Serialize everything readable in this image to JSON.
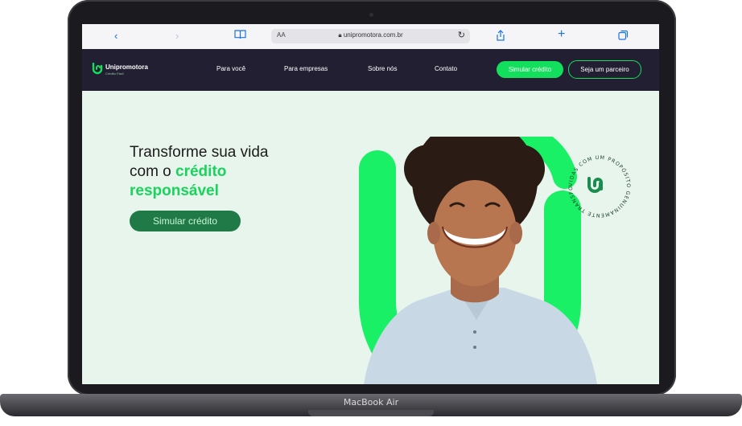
{
  "device": {
    "label": "MacBook Air"
  },
  "browser": {
    "reader_label": "AA",
    "url": "unipromotora.com.br",
    "icons": [
      "back-icon",
      "forward-icon",
      "bookmarks-icon",
      "lock-icon",
      "reload-icon",
      "share-icon",
      "new-tab-icon",
      "tabs-icon"
    ]
  },
  "site": {
    "logo_name": "Unipromotora",
    "logo_sub": "Crédito Fácil",
    "nav": [
      "Para você",
      "Para empresas",
      "Sobre nós",
      "Contato"
    ],
    "cta_primary": "Simular crédito",
    "cta_secondary": "Seja um parceiro",
    "accent": "#12e05c",
    "nav_bg": "#221f33",
    "hero_bg": "#e8f5ec"
  },
  "hero": {
    "line1": "Transforme sua vida",
    "line2_prefix": "com o ",
    "line2_highlight": "crédito",
    "line3_highlight": "responsável",
    "cta": "Simular crédito",
    "seal_text": "VIDAS COM UM PROPÓSITO GENUINAMENTE TRANSFORMANDO"
  }
}
